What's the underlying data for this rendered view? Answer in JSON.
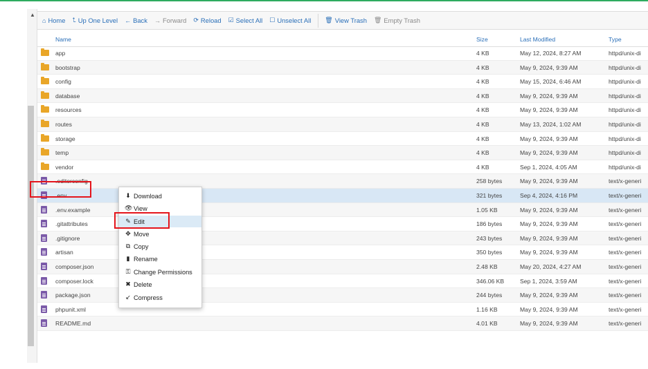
{
  "toolbar": {
    "home": "Home",
    "up_one_level": "Up One Level",
    "back": "Back",
    "forward": "Forward",
    "reload": "Reload",
    "select_all": "Select All",
    "unselect_all": "Unselect All",
    "view_trash": "View Trash",
    "empty_trash": "Empty Trash"
  },
  "columns": {
    "name": "Name",
    "size": "Size",
    "last_modified": "Last Modified",
    "type": "Type"
  },
  "files": [
    {
      "name": "app",
      "size": "4 KB",
      "modified": "May 12, 2024, 8:27 AM",
      "type": "httpd/unix-di",
      "kind": "folder"
    },
    {
      "name": "bootstrap",
      "size": "4 KB",
      "modified": "May 9, 2024, 9:39 AM",
      "type": "httpd/unix-di",
      "kind": "folder"
    },
    {
      "name": "config",
      "size": "4 KB",
      "modified": "May 15, 2024, 6:46 AM",
      "type": "httpd/unix-di",
      "kind": "folder"
    },
    {
      "name": "database",
      "size": "4 KB",
      "modified": "May 9, 2024, 9:39 AM",
      "type": "httpd/unix-di",
      "kind": "folder"
    },
    {
      "name": "resources",
      "size": "4 KB",
      "modified": "May 9, 2024, 9:39 AM",
      "type": "httpd/unix-di",
      "kind": "folder"
    },
    {
      "name": "routes",
      "size": "4 KB",
      "modified": "May 13, 2024, 1:02 AM",
      "type": "httpd/unix-di",
      "kind": "folder"
    },
    {
      "name": "storage",
      "size": "4 KB",
      "modified": "May 9, 2024, 9:39 AM",
      "type": "httpd/unix-di",
      "kind": "folder"
    },
    {
      "name": "temp",
      "size": "4 KB",
      "modified": "May 9, 2024, 9:39 AM",
      "type": "httpd/unix-di",
      "kind": "folder"
    },
    {
      "name": "vendor",
      "size": "4 KB",
      "modified": "Sep 1, 2024, 4:05 AM",
      "type": "httpd/unix-di",
      "kind": "folder"
    },
    {
      "name": ".editorconfig",
      "size": "258 bytes",
      "modified": "May 9, 2024, 9:39 AM",
      "type": "text/x-generi",
      "kind": "file"
    },
    {
      "name": ".env",
      "size": "321 bytes",
      "modified": "Sep 4, 2024, 4:16 PM",
      "type": "text/x-generi",
      "kind": "file",
      "selected": true
    },
    {
      "name": ".env.example",
      "size": "1.05 KB",
      "modified": "May 9, 2024, 9:39 AM",
      "type": "text/x-generi",
      "kind": "file"
    },
    {
      "name": ".gitattributes",
      "size": "186 bytes",
      "modified": "May 9, 2024, 9:39 AM",
      "type": "text/x-generi",
      "kind": "file"
    },
    {
      "name": ".gitignore",
      "size": "243 bytes",
      "modified": "May 9, 2024, 9:39 AM",
      "type": "text/x-generi",
      "kind": "file"
    },
    {
      "name": "artisan",
      "size": "350 bytes",
      "modified": "May 9, 2024, 9:39 AM",
      "type": "text/x-generi",
      "kind": "file"
    },
    {
      "name": "composer.json",
      "size": "2.48 KB",
      "modified": "May 20, 2024, 4:27 AM",
      "type": "text/x-generi",
      "kind": "file"
    },
    {
      "name": "composer.lock",
      "size": "346.06 KB",
      "modified": "Sep 1, 2024, 3:59 AM",
      "type": "text/x-generi",
      "kind": "file"
    },
    {
      "name": "package.json",
      "size": "244 bytes",
      "modified": "May 9, 2024, 9:39 AM",
      "type": "text/x-generi",
      "kind": "file"
    },
    {
      "name": "phpunit.xml",
      "size": "1.16 KB",
      "modified": "May 9, 2024, 9:39 AM",
      "type": "text/x-generi",
      "kind": "file"
    },
    {
      "name": "README.md",
      "size": "4.01 KB",
      "modified": "May 9, 2024, 9:39 AM",
      "type": "text/x-generi",
      "kind": "file"
    }
  ],
  "context_menu": [
    {
      "label": "Download",
      "icon": "download-icon"
    },
    {
      "label": "View",
      "icon": "eye-icon"
    },
    {
      "label": "Edit",
      "icon": "pencil-icon",
      "active": true
    },
    {
      "label": "Move",
      "icon": "move-icon"
    },
    {
      "label": "Copy",
      "icon": "copy-icon"
    },
    {
      "label": "Rename",
      "icon": "file-icon"
    },
    {
      "label": "Change Permissions",
      "icon": "key-icon"
    },
    {
      "label": "Delete",
      "icon": "delete-icon"
    },
    {
      "label": "Compress",
      "icon": "compress-icon"
    }
  ],
  "colors": {
    "accent": "#2a6fb8",
    "highlight": "#e4141b",
    "selected_row": "#d8e7f5",
    "folder": "#e9a628",
    "file": "#7b5aa8"
  }
}
